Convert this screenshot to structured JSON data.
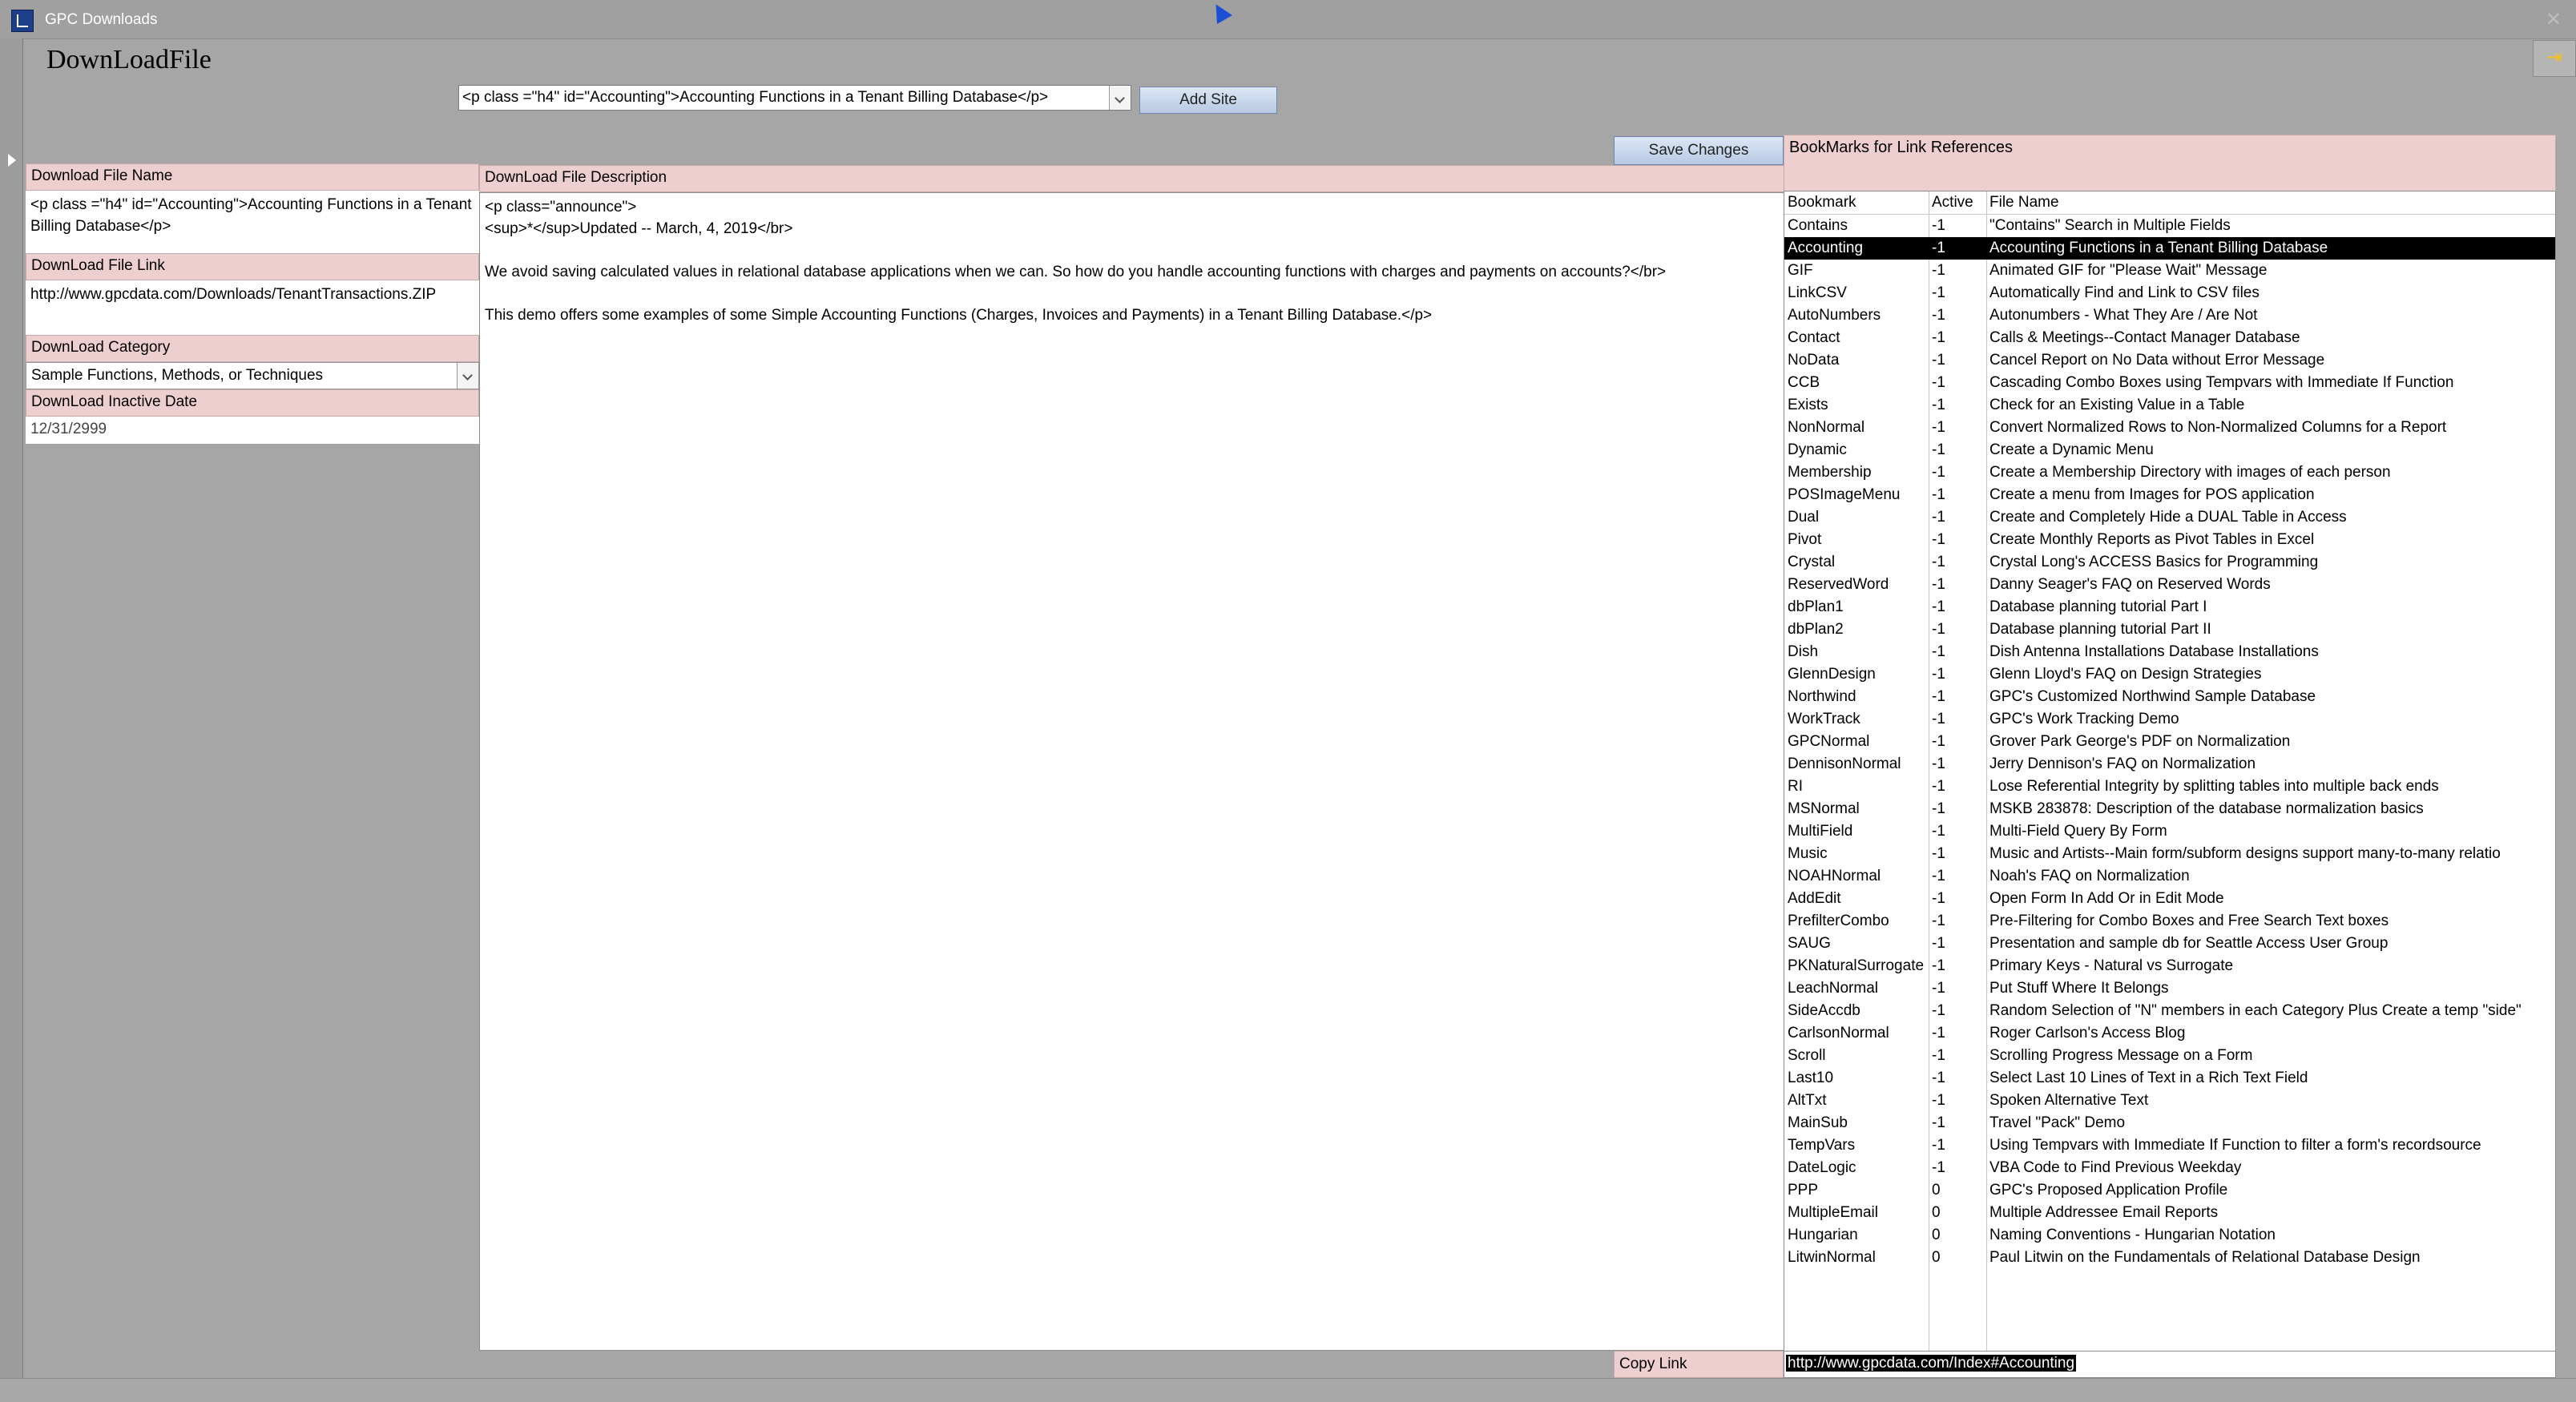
{
  "window": {
    "title": "GPC Downloads"
  },
  "form": {
    "title": "DownLoadFile"
  },
  "toolbar": {
    "site_combo_value": "<p class =\"h4\"  id=\"Accounting\">Accounting Functions in a Tenant Billing Database</p>",
    "add_site_label": "Add Site",
    "save_changes_label": "Save Changes"
  },
  "fields": {
    "file_name_label": "Download File Name",
    "file_name_value": "<p class =\"h4\"  id=\"Accounting\">Accounting Functions in a Tenant Billing Database</p>",
    "file_link_label": "DownLoad File Link",
    "file_link_value": "http://www.gpcdata.com/Downloads/TenantTransactions.ZIP",
    "category_label": "DownLoad Category",
    "category_value": "Sample Functions, Methods, or Techniques",
    "inactive_date_label": "DownLoad Inactive Date",
    "inactive_date_value": "12/31/2999"
  },
  "description": {
    "label": "DownLoad File Description",
    "lines": [
      "<p class=\"announce\">",
      "<sup>*</sup>Updated -- March, 4, 2019</br>",
      "",
      "We avoid saving calculated values in relational database applications when we can. So how do you handle accounting functions with charges and payments on accounts?</br>",
      "",
      "This demo offers some examples of some Simple Accounting Functions (Charges, Invoices and Payments) in a Tenant Billing Database.</p>"
    ]
  },
  "bookmarks": {
    "header": "BookMarks for Link References",
    "columns": [
      "Bookmark",
      "Active",
      "File Name"
    ],
    "rows": [
      [
        "Contains",
        "-1",
        "\"Contains\" Search in Multiple Fields"
      ],
      [
        "Accounting",
        "-1",
        "Accounting Functions in a Tenant Billing Database"
      ],
      [
        "GIF",
        "-1",
        "Animated GIF for \"Please Wait\" Message"
      ],
      [
        "LinkCSV",
        "-1",
        "Automatically Find and Link to CSV files"
      ],
      [
        "AutoNumbers",
        "-1",
        "Autonumbers - What They Are / Are Not"
      ],
      [
        "Contact",
        "-1",
        "Calls & Meetings--Contact Manager Database"
      ],
      [
        "NoData",
        "-1",
        "Cancel Report on No Data without Error Message"
      ],
      [
        "CCB",
        "-1",
        "Cascading Combo Boxes using Tempvars with Immediate If Function"
      ],
      [
        "Exists",
        "-1",
        "Check for an Existing Value in a Table"
      ],
      [
        "NonNormal",
        "-1",
        "Convert Normalized Rows to Non-Normalized Columns for a Report"
      ],
      [
        "Dynamic",
        "-1",
        "Create a Dynamic Menu"
      ],
      [
        "Membership",
        "-1",
        "Create a Membership Directory with images of each person"
      ],
      [
        "POSImageMenu",
        "-1",
        "Create a menu from Images for  POS application"
      ],
      [
        "Dual",
        "-1",
        "Create and Completely Hide a DUAL Table in Access"
      ],
      [
        "Pivot",
        "-1",
        "Create Monthly Reports as Pivot Tables in Excel"
      ],
      [
        "Crystal",
        "-1",
        "Crystal Long's ACCESS Basics for Programming"
      ],
      [
        "ReservedWord",
        "-1",
        "Danny Seager's FAQ on Reserved Words"
      ],
      [
        "dbPlan1",
        "-1",
        "Database planning tutorial Part I"
      ],
      [
        "dbPlan2",
        "-1",
        "Database planning tutorial Part II"
      ],
      [
        "Dish",
        "-1",
        "Dish Antenna Installations Database Installations"
      ],
      [
        "GlennDesign",
        "-1",
        "Glenn Lloyd's FAQ on Design Strategies"
      ],
      [
        "Northwind",
        "-1",
        "GPC's Customized Northwind Sample Database"
      ],
      [
        "WorkTrack",
        "-1",
        "GPC's Work Tracking Demo"
      ],
      [
        "GPCNormal",
        "-1",
        "Grover Park George's PDF on Normalization"
      ],
      [
        "DennisonNormal",
        "-1",
        "Jerry Dennison's FAQ on Normalization"
      ],
      [
        "RI",
        "-1",
        "Lose Referential Integrity by splitting tables into multiple back ends"
      ],
      [
        "MSNormal",
        "-1",
        "MSKB 283878: Description of the database normalization basics"
      ],
      [
        "MultiField",
        "-1",
        "Multi-Field Query By Form"
      ],
      [
        "Music",
        "-1",
        "Music and Artists--Main form/subform designs support many-to-many relatio"
      ],
      [
        "NOAHNormal",
        "-1",
        "Noah's FAQ on Normalization"
      ],
      [
        "AddEdit",
        "-1",
        "Open Form In Add Or in Edit Mode"
      ],
      [
        "PrefilterCombo",
        "-1",
        "Pre-Filtering for Combo Boxes and Free Search Text boxes"
      ],
      [
        "SAUG",
        "-1",
        "Presentation and sample db for Seattle Access User Group"
      ],
      [
        "PKNaturalSurrogate",
        "-1",
        "Primary Keys - Natural vs Surrogate"
      ],
      [
        "LeachNormal",
        "-1",
        "Put Stuff Where It Belongs"
      ],
      [
        "SideAccdb",
        "-1",
        "Random Selection of \"N\" members in each Category Plus Create a temp \"side\""
      ],
      [
        "CarlsonNormal",
        "-1",
        "Roger Carlson's Access Blog"
      ],
      [
        "Scroll",
        "-1",
        "Scrolling Progress Message on a Form"
      ],
      [
        "Last10",
        "-1",
        "Select Last 10 Lines of Text in a Rich Text Field"
      ],
      [
        "AltTxt",
        "-1",
        "Spoken Alternative Text"
      ],
      [
        "MainSub",
        "-1",
        "Travel \"Pack\" Demo"
      ],
      [
        "TempVars",
        "-1",
        "Using Tempvars with Immediate If Function to filter a form's recordsource"
      ],
      [
        "DateLogic",
        "-1",
        "VBA Code to Find Previous Weekday"
      ],
      [
        "PPP",
        "0",
        "GPC's Proposed Application Profile"
      ],
      [
        "MultipleEmail",
        "0",
        "Multiple Addressee Email Reports"
      ],
      [
        "Hungarian",
        "0",
        "Naming Conventions - Hungarian Notation"
      ],
      [
        "LitwinNormal",
        "0",
        "Paul Litwin on the Fundamentals of Relational Database Design"
      ]
    ],
    "selected_index": 1
  },
  "copy_link": {
    "label": "Copy Link",
    "value": "http://www.gpcdata.com/Index#Accounting"
  },
  "colors": {
    "label_bg": "#eecfcf",
    "form_bg": "#a6a6a6",
    "selected_row_bg": "#000000"
  }
}
